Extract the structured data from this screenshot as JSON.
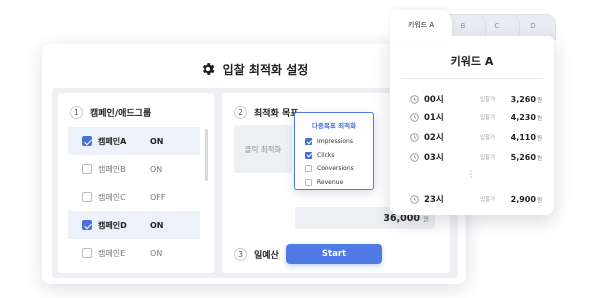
{
  "header": {
    "title": "입찰 최적화 설정",
    "icon": "gear-icon"
  },
  "campaign_section": {
    "number": "1",
    "label": "캠페인/애드그룹",
    "rows": [
      {
        "name": "캠페인A",
        "status": "ON",
        "checked": true
      },
      {
        "name": "캠페인B",
        "status": "ON",
        "checked": false
      },
      {
        "name": "캠페인C",
        "status": "OFF",
        "checked": false
      },
      {
        "name": "캠페인D",
        "status": "ON",
        "checked": true
      },
      {
        "name": "캠페인E",
        "status": "ON",
        "checked": false
      }
    ]
  },
  "goal_section": {
    "number": "2",
    "label": "최적화 목표",
    "field_value": "클릭 최적화"
  },
  "goal_dropdown": {
    "title": "다중목표 최적화",
    "options": [
      {
        "label": "Impressions",
        "checked": true
      },
      {
        "label": "Clicks",
        "checked": true
      },
      {
        "label": "Conversions",
        "checked": false
      },
      {
        "label": "Revenue",
        "checked": false
      }
    ]
  },
  "budget_section": {
    "number": "3",
    "label": "일예산",
    "value": "36,000",
    "unit": "원"
  },
  "start_button": {
    "label": "Start"
  },
  "keyword_panel": {
    "tabs": [
      "키워드 A",
      "B",
      "C",
      "D"
    ],
    "title": "키워드 A",
    "price_label": "입찰가",
    "rows": [
      {
        "hour": "00시",
        "price": "3,260",
        "unit": "원"
      },
      {
        "hour": "01시",
        "price": "4,230",
        "unit": "원"
      },
      {
        "hour": "02시",
        "price": "4,110",
        "unit": "원"
      },
      {
        "hour": "03시",
        "price": "5,260",
        "unit": "원"
      },
      {
        "hour": "23시",
        "price": "2,900",
        "unit": "원"
      }
    ]
  },
  "colors": {
    "accent": "#4f7ae6",
    "checkbox": "#4a72d6",
    "panel_bg": "#eef0f4"
  }
}
